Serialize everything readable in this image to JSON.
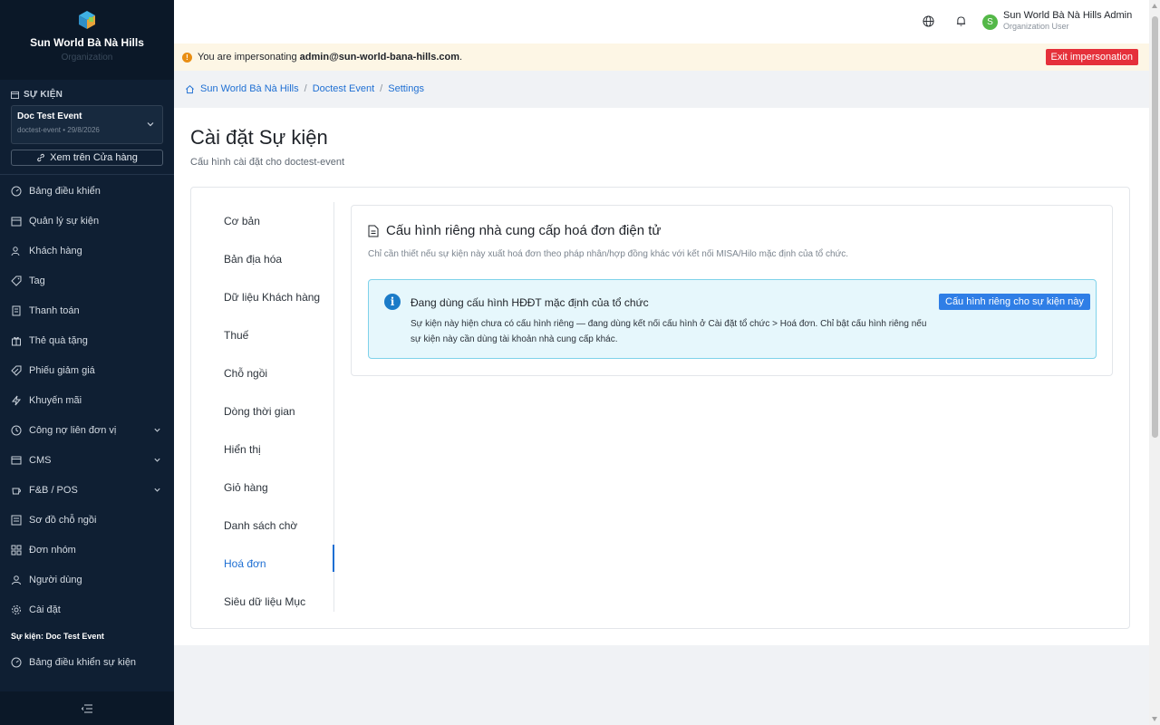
{
  "brand": {
    "name": "Sun World Bà Nà Hills",
    "sub": "Organization"
  },
  "sidebar": {
    "section_label": "SỰ KIỆN",
    "event": {
      "name": "Doc Test Event",
      "meta": "doctest-event • 29/8/2026"
    },
    "store_button": "Xem trên Cửa hàng",
    "items": [
      {
        "label": "Bảng điều khiển",
        "icon": "dashboard-icon"
      },
      {
        "label": "Quản lý sự kiện",
        "icon": "calendar-icon"
      },
      {
        "label": "Khách hàng",
        "icon": "users-icon"
      },
      {
        "label": "Tag",
        "icon": "tag-icon"
      },
      {
        "label": "Thanh toán",
        "icon": "receipt-icon"
      },
      {
        "label": "Thẻ quà tặng",
        "icon": "gift-icon"
      },
      {
        "label": "Phiếu giảm giá",
        "icon": "coupon-icon"
      },
      {
        "label": "Khuyến mãi",
        "icon": "bolt-icon"
      },
      {
        "label": "Công nợ liên đơn vị",
        "icon": "ledger-icon"
      },
      {
        "label": "CMS",
        "icon": "cms-icon"
      },
      {
        "label": "F&B / POS",
        "icon": "coffee-icon"
      },
      {
        "label": "Sơ đồ chỗ ngồi",
        "icon": "seatmap-icon"
      },
      {
        "label": "Đơn nhóm",
        "icon": "grid-icon"
      },
      {
        "label": "Người dùng",
        "icon": "user-icon"
      },
      {
        "label": "Cài đặt",
        "icon": "gear-icon"
      }
    ],
    "event_section": "Sự kiện: Doc Test Event",
    "event_items": [
      {
        "label": "Bảng điều khiển sự kiện",
        "icon": "dashboard-icon"
      }
    ]
  },
  "header": {
    "user_name": "Sun World Bà Nà Hills Admin",
    "user_role": "Organization User",
    "avatar_letter": "S"
  },
  "banner": {
    "prefix": "You are impersonating",
    "email": "admin@sun-world-bana-hills.com",
    "suffix": ".",
    "exit_label": "Exit impersonation"
  },
  "breadcrumb": {
    "home": "Sun World Bà Nà Hills",
    "event": "Doctest Event",
    "current": "Settings",
    "sep": "/"
  },
  "page": {
    "title": "Cài đặt Sự kiện",
    "subtitle": "Cấu hình cài đặt cho doctest-event"
  },
  "tabs": [
    "Cơ bản",
    "Bản địa hóa",
    "Dữ liệu Khách hàng",
    "Thuế",
    "Chỗ ngồi",
    "Dòng thời gian",
    "Hiển thị",
    "Giỏ hàng",
    "Danh sách chờ",
    "Hoá đơn",
    "Siêu dữ liệu Mục"
  ],
  "active_tab": "Hoá đơn",
  "panel": {
    "title": "Cấu hình riêng nhà cung cấp hoá đơn điện tử",
    "desc": "Chỉ cần thiết nếu sự kiện này xuất hoá đơn theo pháp nhân/hợp đồng khác với kết nối MISA/Hilo mặc định của tổ chức.",
    "info_head": "Đang dùng cấu hình HĐĐT mặc định của tổ chức",
    "info_body": "Sự kiện này hiện chưa có cấu hình riêng — đang dùng kết nối cấu hình ở Cài đặt tổ chức > Hoá đơn. Chỉ bật cấu hình riêng nếu sự kiện này cần dùng tài khoản nhà cung cấp khác.",
    "info_button": "Cấu hình riêng cho sự kiện này"
  }
}
